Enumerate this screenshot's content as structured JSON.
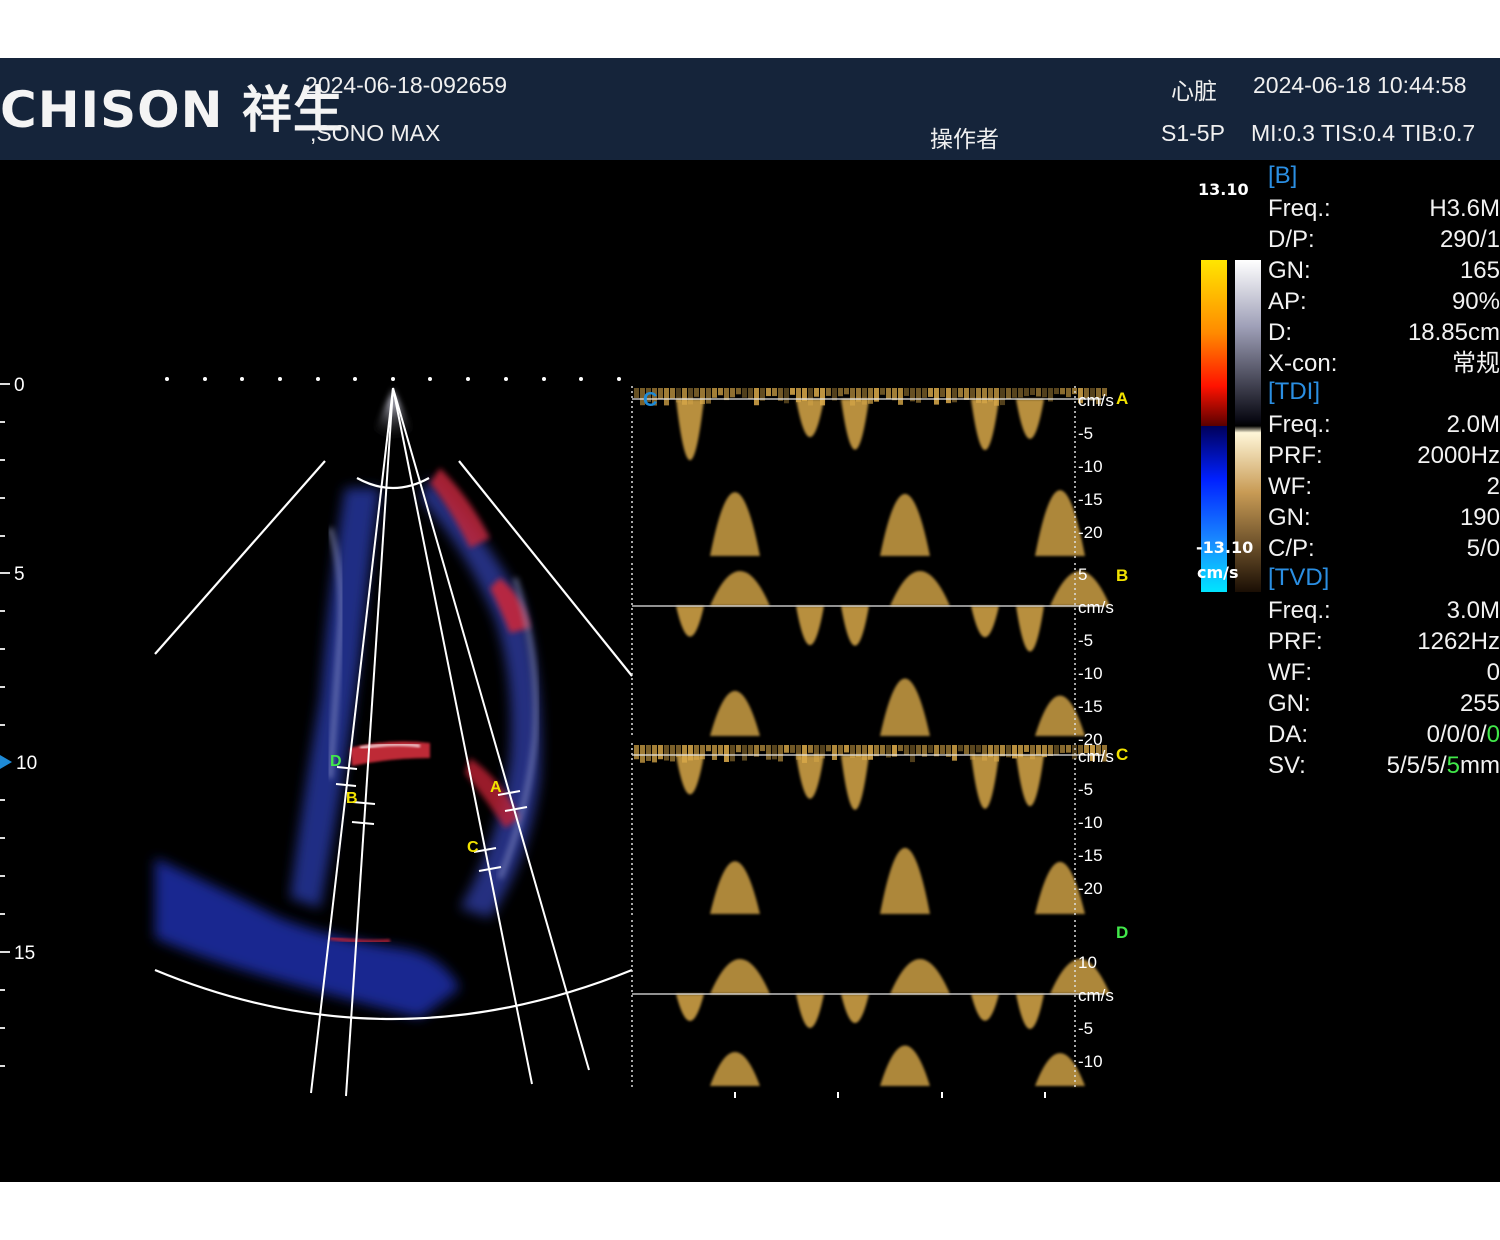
{
  "header": {
    "brand": "CHISON 祥生",
    "exam_id": "2024-06-18-092659",
    "device": ",SONO MAX",
    "operator_label": "操作者",
    "organ": "心脏",
    "datetime": "2024-06-18 10:44:58",
    "probe": "S1-5P",
    "indices": "MI:0.3 TIS:0.4 TIB:0.7"
  },
  "depth_scale": {
    "labels": [
      "0",
      "5",
      "10",
      "15"
    ]
  },
  "markers": {
    "A": "A",
    "B": "B",
    "C": "C",
    "D": "D"
  },
  "traces": [
    {
      "id": "A",
      "letter": "A",
      "letter_color": "#f2e200",
      "top_label": "cm/s",
      "ticks": [
        "-5",
        "-10",
        "-15",
        "-20"
      ],
      "top_num": "",
      "sublabel": "C"
    },
    {
      "id": "B",
      "letter": "B",
      "letter_color": "#f2e200",
      "top_label": "cm/s",
      "ticks": [
        "-5",
        "-10",
        "-15",
        "-20"
      ],
      "top_num": "5",
      "sublabel": ""
    },
    {
      "id": "C",
      "letter": "C",
      "letter_color": "#f2e200",
      "top_label": "cm/s",
      "ticks": [
        "-5",
        "-10",
        "-15",
        "-20"
      ],
      "top_num": "",
      "sublabel": ""
    },
    {
      "id": "D",
      "letter": "D",
      "letter_color": "#41e84a",
      "top_label": "cm/s",
      "ticks": [
        "-5",
        "-10"
      ],
      "top_num": "10",
      "sublabel": ""
    }
  ],
  "colorbar": {
    "max": "13.10",
    "min": "-13.10",
    "unit": "cm/s"
  },
  "params": {
    "b_title": "[B]",
    "b_rows": [
      {
        "k": "Freq.:",
        "v": "H3.6M"
      },
      {
        "k": "D/P:",
        "v": "290/1"
      },
      {
        "k": "GN:",
        "v": "165"
      },
      {
        "k": "AP:",
        "v": "90%"
      },
      {
        "k": "D:",
        "v": "18.85cm"
      },
      {
        "k": "X-con:",
        "v": "常规"
      }
    ],
    "tdi_title": "[TDI]",
    "tdi_rows": [
      {
        "k": "Freq.:",
        "v": "2.0M"
      },
      {
        "k": "PRF:",
        "v": "2000Hz"
      },
      {
        "k": "WF:",
        "v": "2"
      },
      {
        "k": "GN:",
        "v": "190"
      },
      {
        "k": "C/P:",
        "v": "5/0"
      }
    ],
    "tvd_title": "[TVD]",
    "tvd_rows": [
      {
        "k": "Freq.:",
        "v": "3.0M"
      },
      {
        "k": "PRF:",
        "v": "1262Hz"
      },
      {
        "k": "WF:",
        "v": "0"
      },
      {
        "k": "GN:",
        "v": "255"
      }
    ],
    "da": {
      "k": "DA:",
      "v_main": "0/0/0/",
      "v_green": "0"
    },
    "sv": {
      "k": "SV:",
      "v_main": "5/5/5/",
      "v_green": "5",
      "v_unit": "mm"
    }
  },
  "colors": {
    "header_bg": "#15243a",
    "accent_blue": "#2b8fe3",
    "marker_yellow": "#f2e200",
    "marker_green": "#41e84a",
    "doppler_gold": "#d9a94a"
  }
}
